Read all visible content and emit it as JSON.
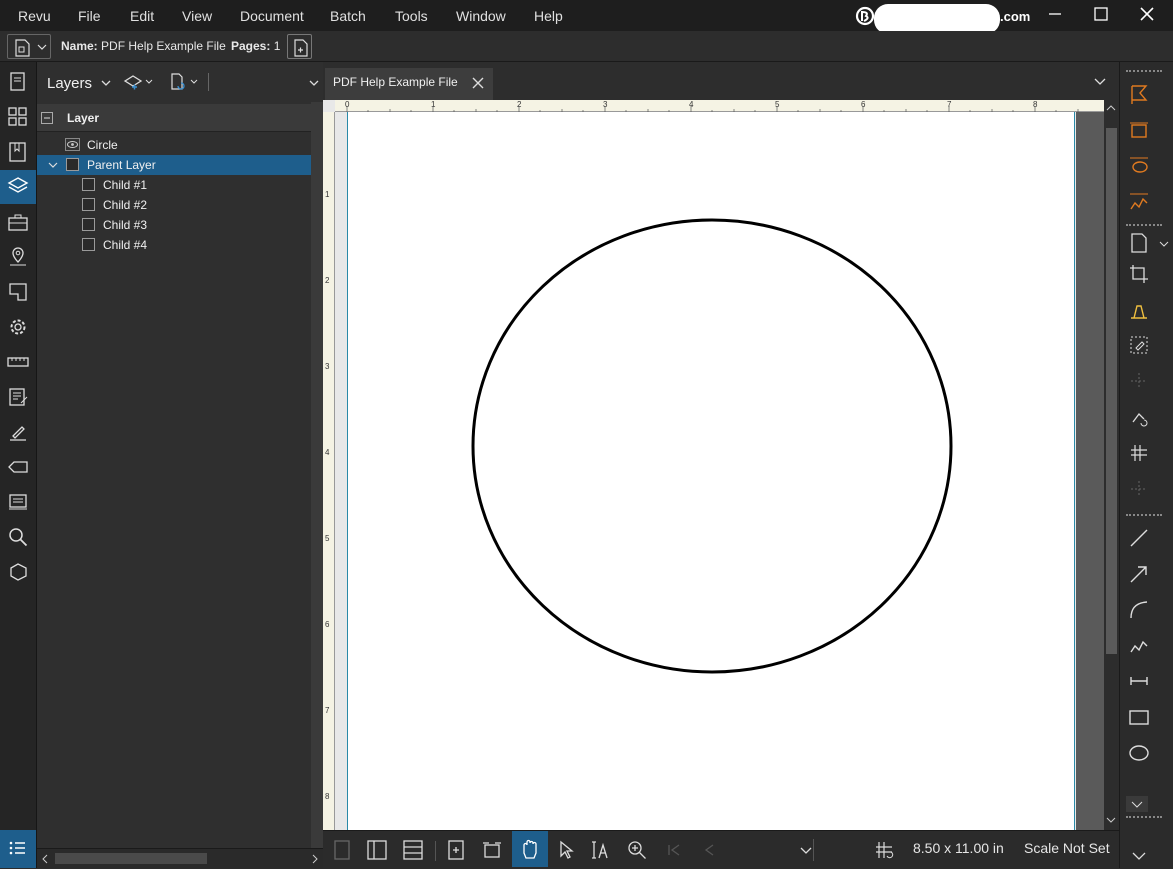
{
  "menubar": {
    "items": [
      "Revu",
      "File",
      "Edit",
      "View",
      "Document",
      "Batch",
      "Tools",
      "Window",
      "Help"
    ],
    "account_suffix": ".com"
  },
  "docbar": {
    "name_label": "Name:",
    "name_value": "PDF Help Example File",
    "pages_label": "Pages:",
    "pages_value": "1"
  },
  "layers_panel": {
    "title": "Layers",
    "column_header": "Layer",
    "tree": [
      {
        "label": "Circle",
        "indent": 0,
        "icon": "eye-icon",
        "selected": false
      },
      {
        "label": "Parent Layer",
        "indent": 0,
        "icon": "checkbox",
        "expanded": true,
        "selected": true
      },
      {
        "label": "Child #1",
        "indent": 1,
        "icon": "checkbox",
        "selected": false
      },
      {
        "label": "Child #2",
        "indent": 1,
        "icon": "checkbox",
        "selected": false
      },
      {
        "label": "Child #3",
        "indent": 1,
        "icon": "checkbox",
        "selected": false
      },
      {
        "label": "Child #4",
        "indent": 1,
        "icon": "checkbox",
        "selected": false
      }
    ]
  },
  "tabs": [
    {
      "label": "PDF Help Example File"
    }
  ],
  "ruler": {
    "ticks": [
      "0",
      "1",
      "2",
      "3",
      "4",
      "5",
      "6",
      "7",
      "8"
    ]
  },
  "vruler": {
    "ticks": [
      "1",
      "2",
      "3",
      "4",
      "5",
      "6",
      "7",
      "8"
    ]
  },
  "statusbar": {
    "page_size": "8.50 x 11.00 in",
    "scale": "Scale Not Set"
  },
  "colors": {
    "accent": "#1e5e8c",
    "tool_orange": "#e07a20",
    "tool_yellow": "#f0c040"
  }
}
